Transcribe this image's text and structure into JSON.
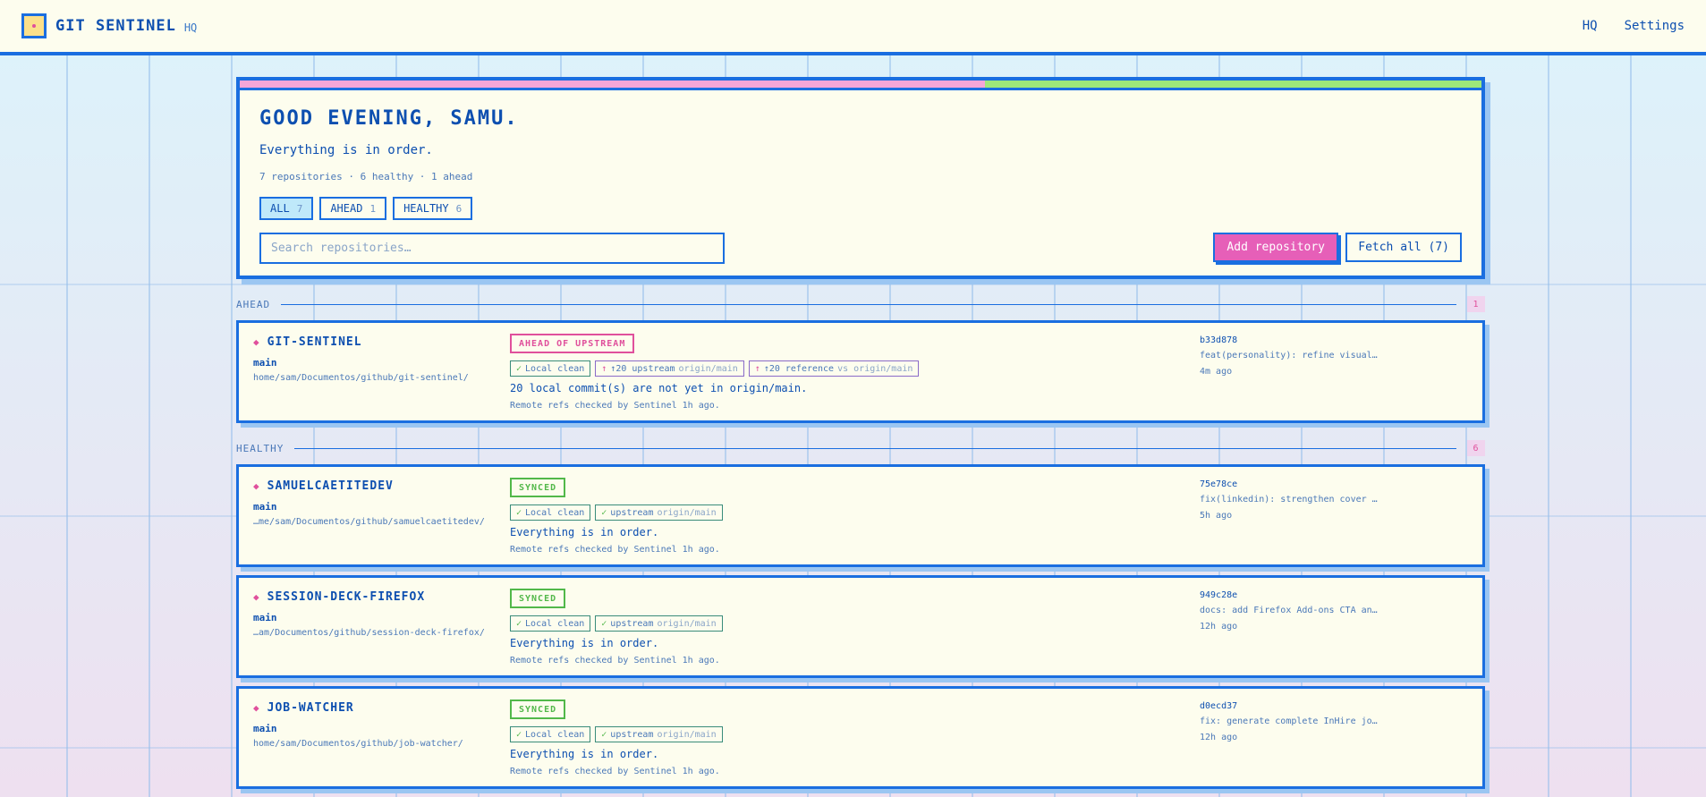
{
  "app": {
    "brand": "GIT SENTINEL",
    "brand_sub": "HQ"
  },
  "nav": {
    "hq": "HQ",
    "settings": "Settings"
  },
  "hero": {
    "greeting": "GOOD EVENING, SAMU.",
    "status": "Everything is in order.",
    "summary": "7 repositories · 6 healthy · 1 ahead",
    "progress_ahead_fraction": 0.6,
    "filters": [
      {
        "label": "ALL",
        "count": "7",
        "active": true
      },
      {
        "label": "AHEAD",
        "count": "1",
        "active": false
      },
      {
        "label": "HEALTHY",
        "count": "6",
        "active": false
      }
    ],
    "search_placeholder": "Search repositories…",
    "add_label": "Add repository",
    "fetch_label": "Fetch all (7)"
  },
  "sections": {
    "ahead": {
      "label": "AHEAD",
      "count": "1"
    },
    "healthy": {
      "label": "HEALTHY",
      "count": "6"
    }
  },
  "repos": [
    {
      "name": "GIT-SENTINEL",
      "branch": "main",
      "path": "home/sam/Documentos/github/git-sentinel/",
      "badge": "AHEAD OF UPSTREAM",
      "chip1": "Local clean",
      "chip2_main": "↑20 upstream",
      "chip2_ref": "origin/main",
      "chip3_main": "↑20 reference",
      "chip3_ref": "vs origin/main",
      "message": "20 local commit(s) are not yet in origin/main.",
      "checked": "Remote refs checked by Sentinel 1h ago.",
      "sha": "b33d878",
      "commit": "feat(personality): refine visual…",
      "time": "4m ago"
    },
    {
      "name": "SAMUELCAETITEDEV",
      "branch": "main",
      "path": "…me/sam/Documentos/github/samuelcaetitedev/",
      "badge": "SYNCED",
      "chip1": "Local clean",
      "chip2_main": "upstream",
      "chip2_ref": "origin/main",
      "message": "Everything is in order.",
      "checked": "Remote refs checked by Sentinel 1h ago.",
      "sha": "75e78ce",
      "commit": "fix(linkedin): strengthen cover …",
      "time": "5h ago"
    },
    {
      "name": "SESSION-DECK-FIREFOX",
      "branch": "main",
      "path": "…am/Documentos/github/session-deck-firefox/",
      "badge": "SYNCED",
      "chip1": "Local clean",
      "chip2_main": "upstream",
      "chip2_ref": "origin/main",
      "message": "Everything is in order.",
      "checked": "Remote refs checked by Sentinel 1h ago.",
      "sha": "949c28e",
      "commit": "docs: add Firefox Add-ons CTA an…",
      "time": "12h ago"
    },
    {
      "name": "JOB-WATCHER",
      "branch": "main",
      "path": "home/sam/Documentos/github/job-watcher/",
      "badge": "SYNCED",
      "chip1": "Local clean",
      "chip2_main": "upstream",
      "chip2_ref": "origin/main",
      "message": "Everything is in order.",
      "checked": "Remote refs checked by Sentinel 1h ago.",
      "sha": "d0ecd37",
      "commit": "fix: generate complete InHire jo…",
      "time": "12h ago"
    }
  ]
}
